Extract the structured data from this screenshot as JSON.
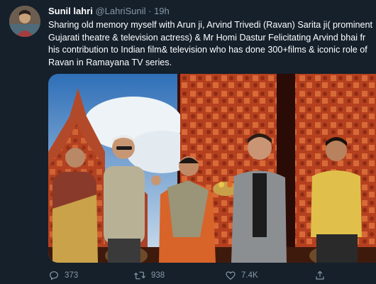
{
  "tweet": {
    "author_name": "Sunil lahri",
    "author_handle": "@LahriSunil",
    "separator": "·",
    "timestamp": "19h",
    "text": "Sharing old memory myself with Arun ji, Arvind Trivedi (Ravan) Sarita ji( prominent Gujarati theatre & television actress) & Mr Homi Dastur Felicitating Arvind bhai fr his contribution to Indian film& television who has done 300+films & iconic role of Ravan in Ramayana TV series."
  },
  "actions": {
    "reply_count": "373",
    "retweet_count": "938",
    "like_count": "7.4K"
  },
  "icons": {
    "reply": "reply-icon",
    "retweet": "retweet-icon",
    "like": "heart-icon",
    "share": "share-icon"
  },
  "colors": {
    "background": "#15202b",
    "secondary_text": "#8899a6"
  }
}
